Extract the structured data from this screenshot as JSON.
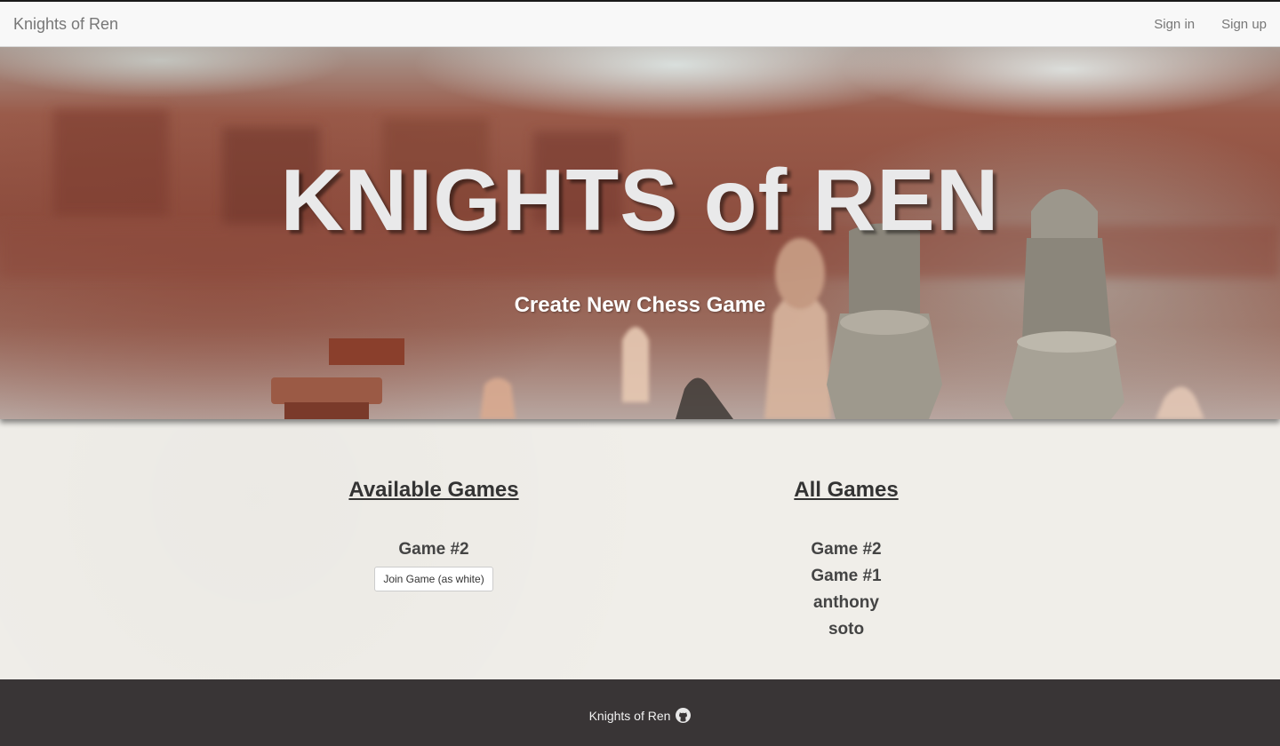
{
  "nav": {
    "brand": "Knights of Ren",
    "links": [
      {
        "label": "Sign in"
      },
      {
        "label": "Sign up"
      }
    ]
  },
  "hero": {
    "title": "KNIGHTS of REN",
    "cta": "Create New Chess Game"
  },
  "available_games": {
    "heading": "Available Games",
    "items": [
      {
        "name": "Game #2",
        "button": "Join Game (as white)"
      }
    ]
  },
  "all_games": {
    "heading": "All Games",
    "items": [
      "Game #2",
      "Game #1",
      "anthony",
      "soto"
    ]
  },
  "footer": {
    "text": "Knights of Ren",
    "icon": "github-icon"
  },
  "colors": {
    "footer_bg": "#393536",
    "page_bg": "#f0eee9",
    "navbar_bg": "#f8f8f8"
  }
}
